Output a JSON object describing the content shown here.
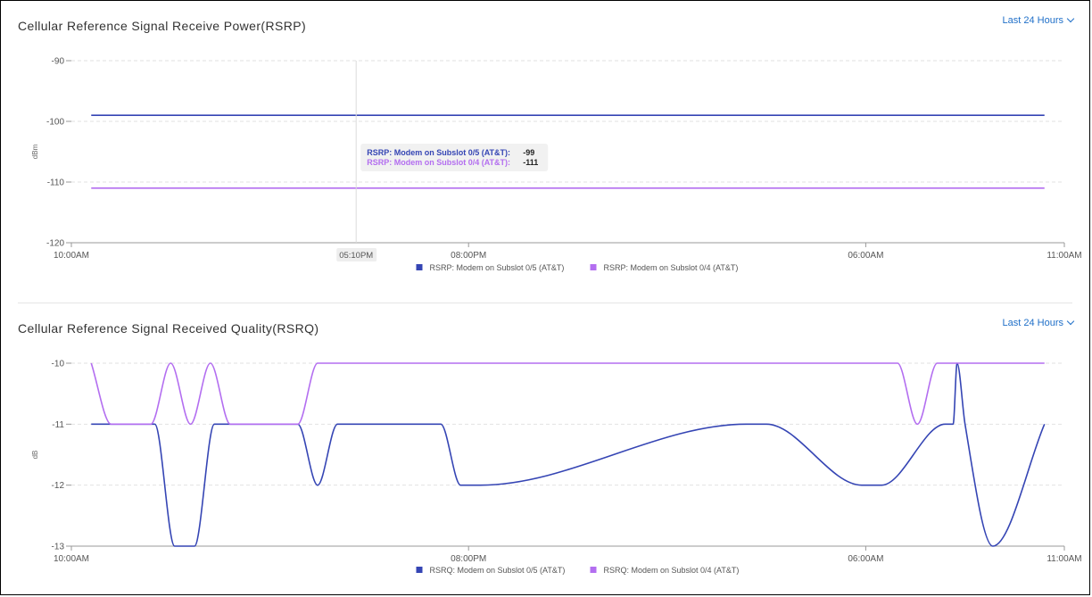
{
  "colors": {
    "series_a": "#3545b4",
    "series_b": "#b36ef0",
    "link": "#1f6fc8",
    "grid": "#e4e4e4"
  },
  "charts": {
    "rsrp": {
      "title": "Cellular Reference Signal Receive Power(RSRP)",
      "range_label": "Last 24 Hours",
      "chart_data": {
        "type": "line",
        "ylabel": "dBm",
        "ylim": [
          -120,
          -90
        ],
        "yticks": [
          -90,
          -100,
          -110,
          -120
        ],
        "xlim": [
          0,
          25
        ],
        "xticks": [
          {
            "label": "10:00AM",
            "value": 0
          },
          {
            "label": "08:00PM",
            "value": 10
          },
          {
            "label": "06:00AM",
            "value": 20
          },
          {
            "label": "11:00AM",
            "value": 25
          }
        ],
        "grid": true,
        "legend": "bottom-center",
        "series": [
          {
            "name": "RSRP: Modem on Subslot 0/5 (AT&T)",
            "color": "#3545b4",
            "x": [
              0.5,
              24.5
            ],
            "y": [
              -99,
              -99
            ]
          },
          {
            "name": "RSRP: Modem on Subslot 0/4 (AT&T)",
            "color": "#b36ef0",
            "x": [
              0.5,
              24.5
            ],
            "y": [
              -111,
              -111
            ]
          }
        ],
        "hover": {
          "x": 7.17,
          "x_label": "05:10PM",
          "rows": [
            {
              "label": "RSRP: Modem on Subslot 0/5 (AT&T):",
              "value": "-99",
              "color": "#3545b4"
            },
            {
              "label": "RSRP: Modem on Subslot 0/4 (AT&T):",
              "value": "-111",
              "color": "#b36ef0"
            }
          ]
        }
      }
    },
    "rsrq": {
      "title": "Cellular Reference Signal Received Quality(RSRQ)",
      "range_label": "Last 24 Hours",
      "chart_data": {
        "type": "line",
        "ylabel": "dB",
        "ylim": [
          -13,
          -10
        ],
        "yticks": [
          -10,
          -11,
          -12,
          -13
        ],
        "xlim": [
          0,
          25
        ],
        "xticks": [
          {
            "label": "10:00AM",
            "value": 0
          },
          {
            "label": "08:00PM",
            "value": 10
          },
          {
            "label": "06:00AM",
            "value": 20
          },
          {
            "label": "11:00AM",
            "value": 25
          }
        ],
        "grid": true,
        "legend": "bottom-center",
        "series": [
          {
            "name": "RSRQ: Modem on Subslot 0/5 (AT&T)",
            "color": "#3545b4",
            "x": [
              0.5,
              2.1,
              2.6,
              3.1,
              3.6,
              5.7,
              6.2,
              6.7,
              9.3,
              9.8,
              10.3,
              17.0,
              17.5,
              19.9,
              20.4,
              22.0,
              22.2,
              22.3,
              22.5,
              23.2,
              24.5
            ],
            "y": [
              -11,
              -11,
              -13,
              -13,
              -11,
              -11,
              -12,
              -11,
              -11,
              -12,
              -12,
              -11,
              -11,
              -12,
              -12,
              -11,
              -11,
              -10,
              -11,
              -13,
              -11
            ]
          },
          {
            "name": "RSRQ: Modem on Subslot 0/4 (AT&T)",
            "color": "#b36ef0",
            "x": [
              0.5,
              1.0,
              2.0,
              2.5,
              3.0,
              3.5,
              4.0,
              5.7,
              6.2,
              20.8,
              21.3,
              21.8,
              24.5
            ],
            "y": [
              -10,
              -11,
              -11,
              -10,
              -11,
              -10,
              -11,
              -11,
              -10,
              -10,
              -11,
              -10,
              -10
            ]
          }
        ]
      }
    }
  }
}
